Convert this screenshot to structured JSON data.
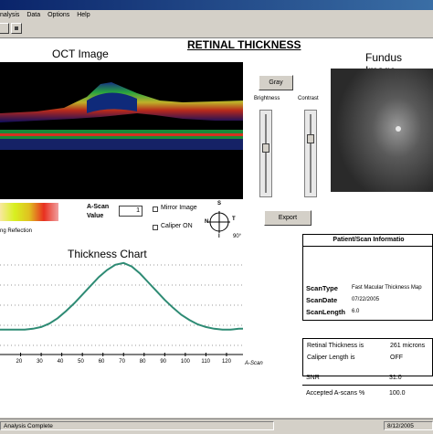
{
  "menu": {
    "items": [
      "nalysis",
      "Data",
      "Options",
      "Help"
    ]
  },
  "page_title": "RETINAL THICKNESS",
  "oct": {
    "title": "OCT Image"
  },
  "fundus": {
    "title": "Fundus Image"
  },
  "controls": {
    "gray_button": "Gray",
    "brightness_label": "Brightness",
    "contrast_label": "Contrast",
    "export_button": "Export"
  },
  "colorbar": {
    "caption": "ng Reflection"
  },
  "ascan": {
    "label_line1": "A-Scan",
    "label_line2": "Value",
    "value": "1"
  },
  "options": {
    "mirror_image": "Mirror Image",
    "caliper_on": "Caliper ON"
  },
  "compass": {
    "top": "S",
    "left": "N",
    "right": "T",
    "bottom": "I",
    "angle": "90°"
  },
  "thickness_chart": {
    "title": "Thickness Chart",
    "xlabel": "A-Scan",
    "tick_labels": [
      "20",
      "30",
      "40",
      "50",
      "60",
      "70",
      "80",
      "90",
      "100",
      "110",
      "120"
    ]
  },
  "chart_data": {
    "type": "line",
    "title": "Thickness Chart",
    "xlabel": "A-Scan",
    "ylabel": "",
    "xlim": [
      10,
      128
    ],
    "x": [
      10,
      14,
      18,
      22,
      26,
      30,
      34,
      38,
      42,
      46,
      50,
      54,
      58,
      62,
      66,
      70,
      74,
      78,
      82,
      86,
      90,
      94,
      98,
      102,
      106,
      110,
      114,
      118,
      122,
      126,
      128
    ],
    "y": [
      20,
      20,
      20,
      20,
      21,
      23,
      27,
      33,
      41,
      50,
      60,
      70,
      80,
      88,
      94,
      96,
      92,
      84,
      74,
      64,
      54,
      45,
      37,
      31,
      26,
      23,
      21,
      20,
      20,
      21,
      21
    ],
    "ylim": [
      0,
      100
    ]
  },
  "patient_info": {
    "header": "Patient/Scan Informatio",
    "rows": [
      {
        "label": "ScanType",
        "value": "Fast Macular Thickness Map"
      },
      {
        "label": "ScanDate",
        "value": "07/22/2005"
      },
      {
        "label": "ScanLength",
        "value": "6.0"
      }
    ]
  },
  "stats": {
    "rows": [
      {
        "label": "Retinal Thickness is",
        "value": "261  microns"
      },
      {
        "label": "Caliper Length is",
        "value": "OFF"
      },
      {
        "label": "SNR",
        "value": "31.0"
      },
      {
        "label": "Accepted  A-scans %",
        "value": "100.0"
      }
    ]
  },
  "status_bar": {
    "message": "Analysis Complete",
    "date": "8/12/2005"
  },
  "colors": {
    "titlebar": "#0a246a",
    "chart_line": "#2e8b74",
    "window_bg": "#d4d0c8"
  }
}
